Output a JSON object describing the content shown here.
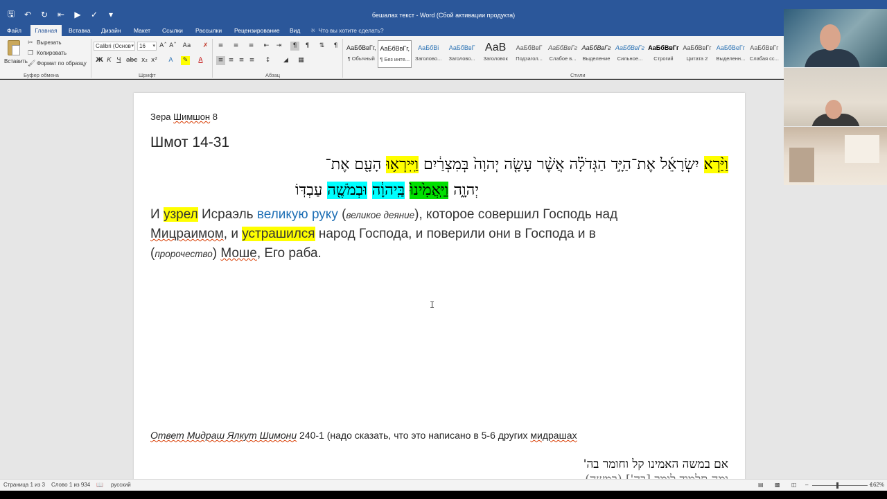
{
  "window": {
    "title": "бешалах текст - Word (Сбой активации продукта)"
  },
  "tabs": [
    {
      "label": "Файл",
      "active": false
    },
    {
      "label": "Главная",
      "active": true
    },
    {
      "label": "Вставка",
      "active": false
    },
    {
      "label": "Дизайн",
      "active": false
    },
    {
      "label": "Макет",
      "active": false
    },
    {
      "label": "Ссылки",
      "active": false
    },
    {
      "label": "Рассылки",
      "active": false
    },
    {
      "label": "Рецензирование",
      "active": false
    },
    {
      "label": "Вид",
      "active": false
    }
  ],
  "tell_me": "Что вы хотите сделать?",
  "clipboard": {
    "paste": "Вставить",
    "cut": "Вырезать",
    "copy": "Копировать",
    "format_painter": "Формат по образцу",
    "group": "Буфер обмена"
  },
  "font": {
    "name": "Calibri (Основ",
    "size": "16",
    "group": "Шрифт"
  },
  "paragraph_group": "Абзац",
  "styles_group": "Стили",
  "styles": [
    {
      "preview": "АаБбВвГг,",
      "name": "¶ Обычный",
      "color": "#222222",
      "selected": false
    },
    {
      "preview": "АаБбВвГг,",
      "name": "¶ Без инте...",
      "color": "#222222",
      "selected": true
    },
    {
      "preview": "АаБбВі",
      "name": "Заголово...",
      "color": "#2e74b5",
      "selected": false
    },
    {
      "preview": "АаБбВвГ",
      "name": "Заголово...",
      "color": "#2e74b5",
      "selected": false
    },
    {
      "preview": "АаВ",
      "name": "Заголовок",
      "color": "#222222",
      "selected": false
    },
    {
      "preview": "АаБбВвГ",
      "name": "Подзагол...",
      "color": "#555555",
      "selected": false
    },
    {
      "preview": "АаБбВвГг",
      "name": "Слабое в...",
      "color": "#555555",
      "selected": false
    },
    {
      "preview": "АаБбВвГг",
      "name": "Выделение",
      "color": "#222222",
      "selected": false
    },
    {
      "preview": "АаБбВвГг",
      "name": "Сильное...",
      "color": "#2e74b5",
      "selected": false
    },
    {
      "preview": "АаБбВвГг",
      "name": "Строгий",
      "color": "#000000",
      "selected": false
    },
    {
      "preview": "АаБбВвГг",
      "name": "Цитата 2",
      "color": "#444444",
      "selected": false
    },
    {
      "preview": "АаБбВеГг",
      "name": "Выделенн...",
      "color": "#2e74b5",
      "selected": false
    },
    {
      "preview": "АаБбВвГг",
      "name": "Слабая сс...",
      "color": "#555555",
      "selected": false
    }
  ],
  "document": {
    "zera": [
      "Зера ",
      "Шимшон",
      " 8"
    ],
    "shmot": "Шмот 14-31",
    "hebrew_line1": {
      "w1": "וַיַּ֨רְא",
      "t1": " יִשְׂרָאֵ֜ל אֶת־הַיָּ֣ד הַגְּדֹלָ֗ה אֲשֶׁ֨ר עָשָׂ֤ה יְהוָה֙ בְּמִצְרַ֔יִם ",
      "w2": "וַיִּֽירְא֥וּ",
      "t2": " הָעָ֖ם אֶת־"
    },
    "hebrew_line2": {
      "t1": "יְהוָ֑ה ",
      "w1": "וַיַּֽאֲמִ֙ינוּ֙",
      "t2": " ",
      "w2": "בַּֽיהוָ֔ה",
      "t3": " ",
      "w3": "וּבְמֹשֶׁ֖ה",
      "t4": " עַבְדּֽוֹ"
    },
    "russian_line1": {
      "a": "И ",
      "hl1": "узрел",
      "b": " Исраэль ",
      "blue": "великую руку",
      "c": " (",
      "it": "великое деяние",
      "d": "), которое совершил Господь над"
    },
    "russian_line2": {
      "a": "Мицраимом",
      "b": ", и ",
      "hl": "устрашился",
      "c": " народ Господа, и поверили они в Господа и в"
    },
    "russian_line3": {
      "a": "(",
      "it": "пророчество",
      "b": ") ",
      "moshe": "Моше",
      "c": ", Его раба."
    },
    "answer": {
      "it": "Ответ Мидраш Ялкут Шимони",
      "rest": " 240-1 (надо сказать, что это написано в 5-6 других ",
      "last": "мидрашах"
    },
    "hebrew_bottom": "אם במשה האמינו קל וחומר בה'",
    "hebrew_bottom2": "ומה תלמוד לומר [בה'] (במשה)"
  },
  "status": {
    "page": "Страница 1 из 3",
    "words": "Слово 1 из 934",
    "language": "русский",
    "zoom": "162%"
  },
  "colors": {
    "accent": "#2b579a",
    "highlight_yellow": "#ffff00",
    "highlight_green": "#00e000",
    "highlight_cyan": "#00ffff"
  }
}
